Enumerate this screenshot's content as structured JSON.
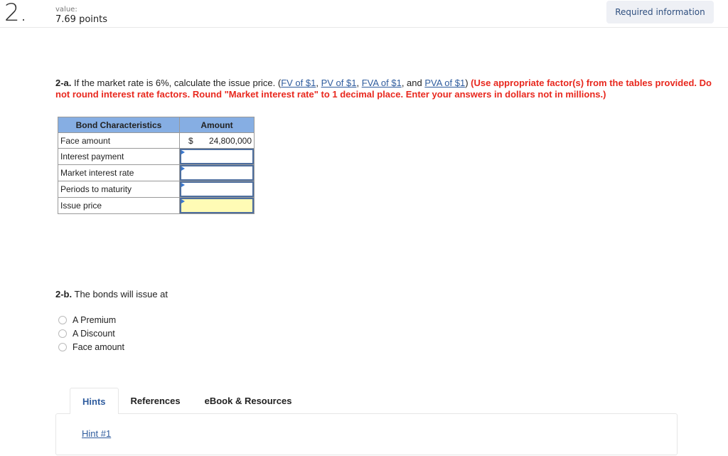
{
  "question": {
    "number": "2.",
    "value_label": "value:",
    "value_points": "7.69 points",
    "required_info_button": "Required information"
  },
  "part_a": {
    "lead": "2-a.",
    "text": " If the market rate is 6%, calculate the issue price. (",
    "links": [
      "FV of $1",
      "PV of $1",
      "FVA of $1",
      "PVA of $1"
    ],
    "sep1": ", ",
    "sep2": ", ",
    "sep3": ", and ",
    "close": ") ",
    "instruction": "(Use appropriate factor(s) from the tables provided. Do not round interest rate factors. Round \"Market interest rate\" to 1 decimal place. Enter your answers in dollars not in millions.)"
  },
  "table": {
    "headers": [
      "Bond Characteristics",
      "Amount"
    ],
    "rows": [
      {
        "label": "Face amount",
        "currency": "$",
        "value": "24,800,000"
      },
      {
        "label": "Interest payment",
        "value": ""
      },
      {
        "label": "Market interest rate",
        "value": ""
      },
      {
        "label": "Periods to maturity",
        "value": ""
      },
      {
        "label": "Issue price",
        "value": ""
      }
    ]
  },
  "part_b": {
    "lead": "2-b.",
    "text": " The bonds will issue at",
    "options": [
      "A Premium",
      "A Discount",
      "Face amount"
    ]
  },
  "tabs": {
    "items": [
      "Hints",
      "References",
      "eBook & Resources"
    ],
    "active": "Hints",
    "hint_link": "Hint #1"
  },
  "colors": {
    "header_blue": "#86aee3",
    "link_blue": "#2f5c9e",
    "instruction_red": "#e8281e",
    "answer_yellow": "#fffbb5"
  }
}
